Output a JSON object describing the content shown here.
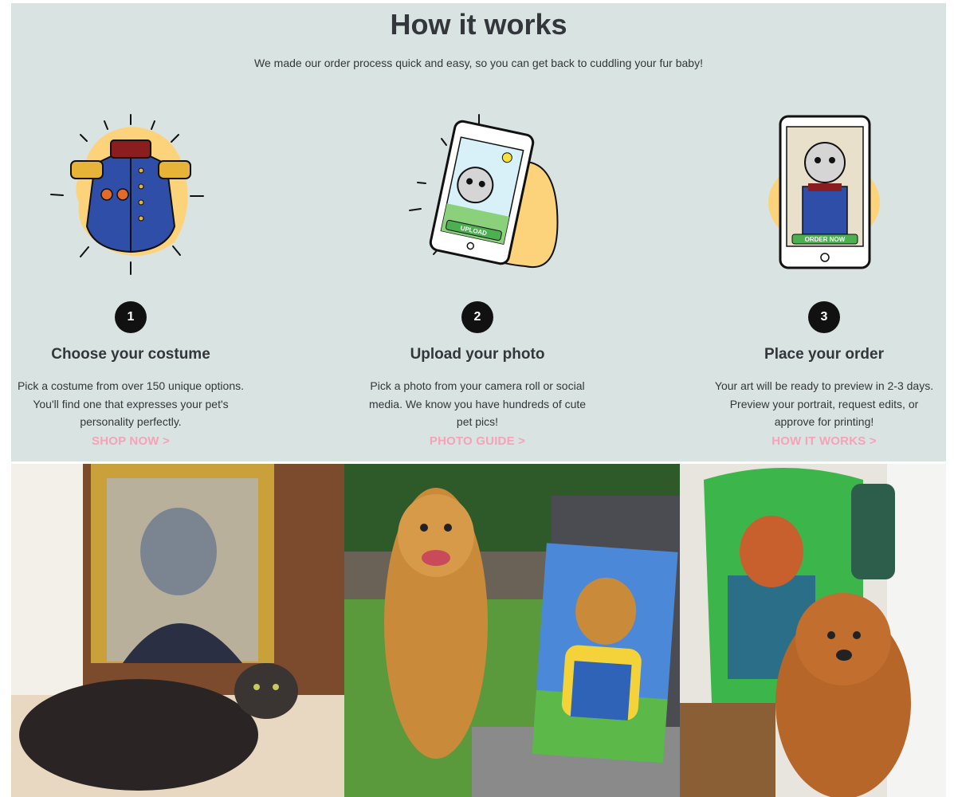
{
  "header": {
    "title": "How it works",
    "subtitle": "We made our order process quick and easy, so you can get back to cuddling your fur baby!"
  },
  "steps": [
    {
      "number": "1",
      "title": "Choose your costume",
      "text": "Pick a costume from over 150 unique options. You'll find one that expresses your pet's personality perfectly.",
      "cta": "SHOP NOW  >",
      "icon": "costume-jacket-icon"
    },
    {
      "number": "2",
      "title": "Upload your photo",
      "text": "Pick a photo from your camera roll or social media. We know you have hundreds of cute pet pics!",
      "cta": "PHOTO GUIDE  >",
      "icon": "phone-upload-icon",
      "art_label": "UPLOAD"
    },
    {
      "number": "3",
      "title": "Place your order",
      "text": "Your art will be ready to preview in 2-3 days. Preview your portrait, request edits, or approve for printing!",
      "cta": "HOW IT WORKS  >",
      "icon": "phone-order-icon",
      "art_label": "ORDER NOW"
    }
  ],
  "gallery": [
    {
      "name": "cat-portrait-photo"
    },
    {
      "name": "golden-retriever-canvas-photo"
    },
    {
      "name": "doodle-sweater-photo"
    }
  ],
  "colors": {
    "background": "#d9e3e1",
    "cta": "#f4a3b8",
    "badge": "#111111",
    "text": "#33363a"
  }
}
